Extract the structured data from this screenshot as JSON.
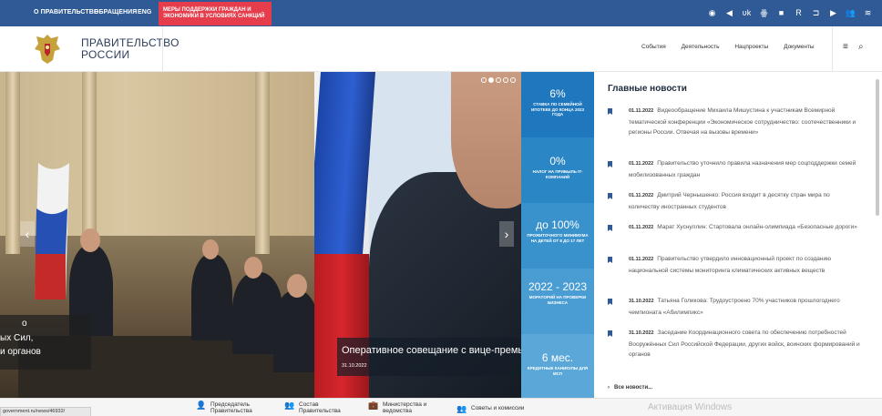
{
  "topbar": {
    "links": [
      "О ПРАВИТЕЛЬСТВЕ",
      "ОБРАЩЕНИЯ",
      "ENG"
    ],
    "promo": "МЕРЫ ПОДДЕРЖКИ ГРАЖДАН И ЭКОНОМИКИ В УСЛОВИЯХ САНКЦИЙ",
    "social_icons": [
      "camera-icon",
      "telegram-icon",
      "vk-icon",
      "ok-icon",
      "dzen-icon",
      "rutube-icon",
      "youtube-icon",
      "users-icon",
      "rss-icon"
    ]
  },
  "header": {
    "title_line1": "ПРАВИТЕЛЬСТВО",
    "title_line2": "РОССИИ",
    "nav": [
      "События",
      "Деятельность",
      "Нацпроекты",
      "Документы"
    ]
  },
  "slides": [
    {
      "caption_line1": "о",
      "caption_line2": "ых Сил,",
      "caption_line3": "и органов"
    },
    {
      "title": "Оперативное совещание с вице-премьерами",
      "date": "31.10.2022"
    }
  ],
  "stats": [
    {
      "value": "6%",
      "label": "СТАВКА ПО СЕМЕЙНОЙ ИПОТЕКЕ ДО КОНЦА 2023 ГОДА",
      "color": "#1f77bd"
    },
    {
      "value": "0%",
      "label": "НАЛОГ НА ПРИБЫЛЬ IT-КОМПАНИЙ",
      "color": "#2b86c6"
    },
    {
      "value": "до 100%",
      "label": "ПРОЖИТОЧНОГО МИНИМУМА НА ДЕТЕЙ ОТ 8 ДО 17 ЛЕТ",
      "color": "#3a92cd"
    },
    {
      "value": "2022 - 2023",
      "label": "МОРАТОРИЙ НА ПРОВЕРКИ БИЗНЕСА",
      "color": "#4a9dd3"
    },
    {
      "value": "6 мес.",
      "label": "КРЕДИТНЫЕ КАНИКУЛЫ ДЛЯ МСП",
      "color": "#5ba8d8"
    }
  ],
  "news": {
    "heading": "Главные новости",
    "items": [
      {
        "date": "01.11.2022",
        "text": "Видеообращение Михаила Мишустина к участникам Всемирной тематической конференции «Экономическое сотрудничество: соотечественники и регионы России. Отвечая на вызовы времени»"
      },
      {
        "date": "01.11.2022",
        "text": "Правительство уточнило правила назначения мер соцподдержки семей мобилизованных граждан"
      },
      {
        "date": "01.11.2022",
        "text": "Дмитрий Чернышенко: Россия входит в десятку стран мира по количеству иностранных студентов"
      },
      {
        "date": "01.11.2022",
        "text": "Марат Хуснуллин: Стартовала онлайн-олимпиада «Безопасные дороги»"
      },
      {
        "date": "01.11.2022",
        "text": "Правительство утвердило инновационный проект по созданию национальной системы мониторинга климатических активных веществ"
      },
      {
        "date": "31.10.2022",
        "text": "Татьяна Голикова: Трудоустроено 70% участников прошлогоднего чемпионата «Абилимпикс»"
      },
      {
        "date": "31.10.2022",
        "text": "Заседание Координационного совета по обеспечению потребностей Вооружённых Сил Российской Федерации, других войск, воинских формирований и органов"
      }
    ],
    "more": "Все новости..."
  },
  "bottom": {
    "url": "government.ru/news/46932/",
    "links": [
      {
        "line1": "Председатель",
        "line2": "Правительства"
      },
      {
        "line1": "Состав",
        "line2": "Правительства"
      },
      {
        "line1": "Министерства и",
        "line2": "ведомства"
      },
      {
        "line1": "Советы и комиссии",
        "line2": ""
      }
    ],
    "watermark": "Активация Windows"
  }
}
